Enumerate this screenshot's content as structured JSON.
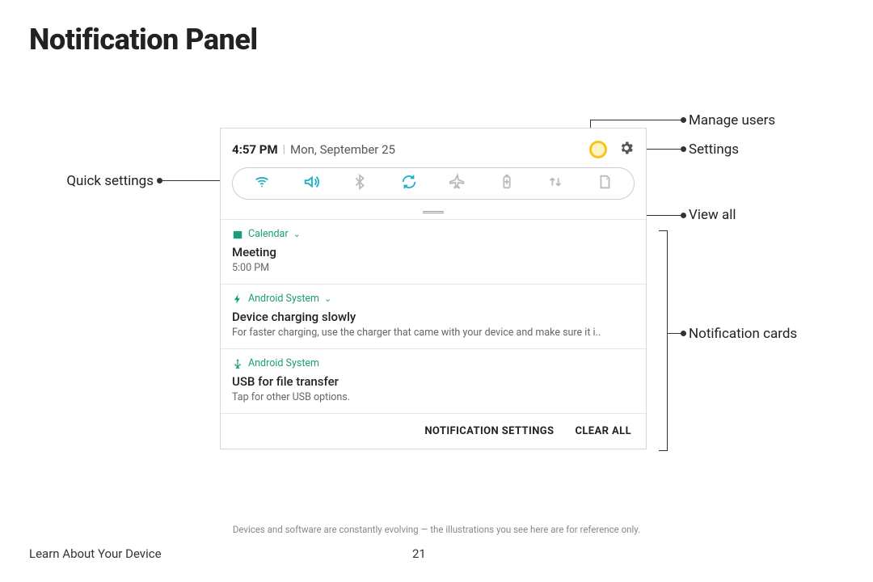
{
  "page": {
    "title": "Notification Panel",
    "disclaimer": "Devices and software are constantly evolving — the illustrations you see here are for reference only.",
    "section": "Learn About Your Device",
    "page_number": "21"
  },
  "callouts": {
    "manage_users": "Manage users",
    "settings": "Settings",
    "quick_settings": "Quick settings",
    "view_all": "View all",
    "notification_cards": "Notification cards"
  },
  "header": {
    "time": "4:57 PM",
    "date": "Mon, September 25"
  },
  "cards": {
    "c1": {
      "app": "Calendar",
      "title": "Meeting",
      "sub": "5:00 PM"
    },
    "c2": {
      "app": "Android System",
      "title": "Device charging slowly",
      "sub": "For faster charging, use the charger that came with your device and make sure it i.."
    },
    "c3": {
      "app": "Android System",
      "title": "USB for file transfer",
      "sub": "Tap for other USB options."
    }
  },
  "footer": {
    "settings_btn": "NOTIFICATION SETTINGS",
    "clear_btn": "CLEAR ALL"
  }
}
